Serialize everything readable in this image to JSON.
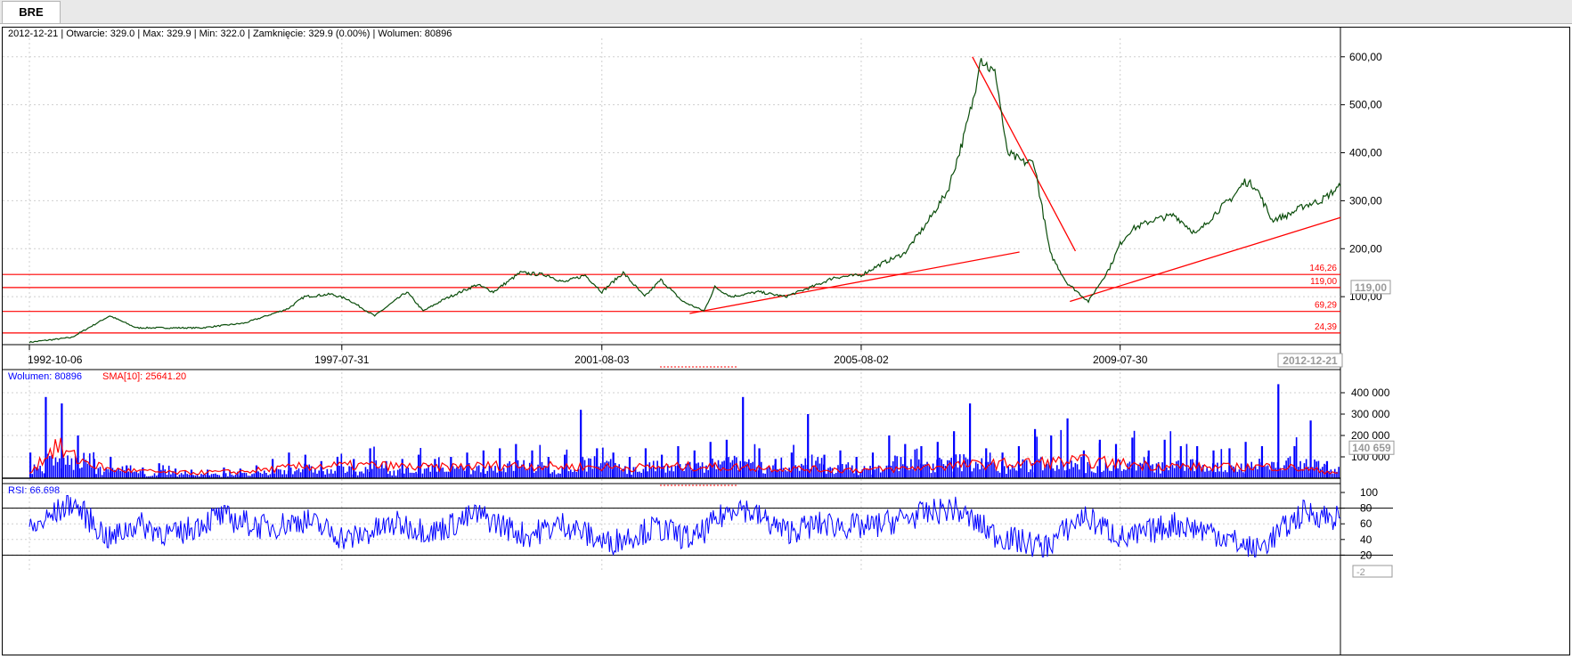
{
  "tab": {
    "label": "BRE"
  },
  "header": {
    "info": "2012-12-21 | Otwarcie: 329.0 | Max: 329.9 | Min: 322.0 | Zamknięcie: 329.9 (0.00%)  | Wolumen: 80896"
  },
  "colors": {
    "price_line": "#0a4d0a",
    "support_lines": "#ff0000",
    "volume_bars": "#0000ff",
    "volume_sma": "#ff0000",
    "rsi_line": "#0000ff",
    "grid": "#cfcfcf"
  },
  "chart_data": [
    {
      "type": "line",
      "title": "",
      "y_axis_labels": [
        "600,00",
        "500,00",
        "400,00",
        "300,00",
        "200,00",
        "100,00"
      ],
      "ylim": [
        0,
        620
      ],
      "x_tick_labels": [
        "1992-10-06",
        "1997-07-31",
        "2001-08-03",
        "2005-08-02",
        "2009-07-30"
      ],
      "x_range": [
        "1992-10-06",
        "2012-12-21"
      ],
      "current_date_label": "2012-12-21",
      "current_value_label": "119,00",
      "horizontal_levels": [
        {
          "value": 146.26,
          "label": "146,26"
        },
        {
          "value": 119.0,
          "label": "119,00"
        },
        {
          "value": 69.29,
          "label": "69,29"
        },
        {
          "value": 24.39,
          "label": "24,39"
        }
      ],
      "trend_lines": [
        {
          "from": [
            "2002-12-10",
            65
          ],
          "to": [
            "2008-01-10",
            193
          ]
        },
        {
          "from": [
            "2007-04-20",
            600
          ],
          "to": [
            "2008-11-20",
            195
          ]
        },
        {
          "from": [
            "2008-10-20",
            90
          ],
          "to": [
            "2012-12-21",
            265
          ]
        }
      ],
      "series": [
        {
          "values_x": [
            "1992-10-06",
            "1993-06-01",
            "1994-01-01",
            "1994-06-01",
            "1995-06-01",
            "1996-02-01",
            "1996-10-01",
            "1997-01-01",
            "1997-06-01",
            "1997-09-01",
            "1998-02-01",
            "1998-08-01",
            "1998-11-01",
            "1999-03-01",
            "1999-09-01",
            "1999-12-01",
            "2000-05-01",
            "2000-10-01",
            "2001-01-01",
            "2001-05-01",
            "2001-08-03",
            "2001-12-01",
            "2002-04-01",
            "2002-07-01",
            "2002-11-01",
            "2003-03-01",
            "2003-05-01",
            "2003-08-01",
            "2004-01-01",
            "2004-06-01",
            "2004-12-01",
            "2005-03-01",
            "2005-08-02",
            "2005-12-01",
            "2006-04-01",
            "2006-08-01",
            "2006-12-01",
            "2007-03-01",
            "2007-05-01",
            "2007-06-01",
            "2007-09-01",
            "2007-11-01",
            "2008-02-01",
            "2008-04-01",
            "2008-07-01",
            "2008-10-01",
            "2009-02-01",
            "2009-06-01",
            "2009-07-30",
            "2009-10-01",
            "2010-02-01",
            "2010-06-01",
            "2010-10-01",
            "2011-02-01",
            "2011-05-01",
            "2011-07-01",
            "2011-09-01",
            "2011-12-01",
            "2012-03-01",
            "2012-06-01",
            "2012-09-01",
            "2012-12-21"
          ],
          "values_y": [
            5,
            15,
            60,
            35,
            35,
            45,
            75,
            100,
            105,
            95,
            60,
            110,
            70,
            95,
            125,
            110,
            150,
            145,
            130,
            145,
            110,
            150,
            100,
            135,
            90,
            70,
            120,
            100,
            110,
            100,
            125,
            140,
            145,
            170,
            190,
            250,
            320,
            430,
            520,
            600,
            560,
            400,
            380,
            380,
            190,
            130,
            90,
            160,
            210,
            240,
            260,
            270,
            230,
            280,
            310,
            340,
            330,
            260,
            270,
            290,
            300,
            330
          ]
        }
      ]
    },
    {
      "type": "bar",
      "title": "",
      "legend_volume": "Wolumen: 80896",
      "legend_sma": "SMA[10]: 25641.20",
      "y_axis_labels": [
        "400 000",
        "300 000",
        "200 000",
        "100 000"
      ],
      "ylim": [
        0,
        450000
      ],
      "current_value_label": "140 659",
      "series": [
        {
          "x": [
            "1992-10-06",
            "1993-01-01",
            "1993-04-01",
            "1993-07-01",
            "1993-10-01",
            "1994-01-01",
            "1994-04-01",
            "1994-07-01",
            "1994-10-01",
            "1995-01-01",
            "1995-04-01",
            "1995-07-01",
            "1995-10-01",
            "1996-01-01",
            "1996-04-01",
            "1996-07-01",
            "1996-10-01",
            "1997-01-01",
            "1997-04-01",
            "1997-07-01",
            "1997-10-01",
            "1998-01-01",
            "1998-04-01",
            "1998-07-01",
            "1998-10-01",
            "1999-01-01",
            "1999-04-01",
            "1999-07-01",
            "1999-10-01",
            "2000-01-01",
            "2000-04-01",
            "2000-07-01",
            "2000-10-01",
            "2001-01-01",
            "2001-04-01",
            "2001-07-01",
            "2001-10-01",
            "2002-01-01",
            "2002-04-01",
            "2002-07-01",
            "2002-10-01",
            "2003-01-01",
            "2003-04-01",
            "2003-07-01",
            "2003-10-01",
            "2004-01-01",
            "2004-04-01",
            "2004-07-01",
            "2004-10-01",
            "2005-01-01",
            "2005-04-01",
            "2005-07-01",
            "2005-10-01",
            "2006-01-01",
            "2006-04-01",
            "2006-07-01",
            "2006-10-01",
            "2007-01-01",
            "2007-04-01",
            "2007-07-01",
            "2007-10-01",
            "2008-01-01",
            "2008-04-01",
            "2008-07-01",
            "2008-10-01",
            "2009-01-01",
            "2009-04-01",
            "2009-07-01",
            "2009-10-01",
            "2010-01-01",
            "2010-04-01",
            "2010-07-01",
            "2010-10-01",
            "2011-01-01",
            "2011-04-01",
            "2011-07-01",
            "2011-10-01",
            "2012-01-01",
            "2012-04-01",
            "2012-07-01",
            "2012-10-01"
          ],
          "values": [
            120000,
            380000,
            350000,
            200000,
            90000,
            100000,
            60000,
            50000,
            70000,
            45000,
            40000,
            40000,
            50000,
            45000,
            60000,
            90000,
            120000,
            110000,
            80000,
            100000,
            90000,
            140000,
            80000,
            90000,
            110000,
            90000,
            100000,
            120000,
            130000,
            140000,
            160000,
            130000,
            100000,
            110000,
            320000,
            140000,
            120000,
            100000,
            140000,
            110000,
            150000,
            130000,
            170000,
            180000,
            380000,
            140000,
            90000,
            120000,
            300000,
            110000,
            130000,
            100000,
            120000,
            200000,
            160000,
            150000,
            170000,
            220000,
            350000,
            140000,
            120000,
            150000,
            230000,
            200000,
            280000,
            130000,
            180000,
            160000,
            190000,
            130000,
            180000,
            150000,
            150000,
            130000,
            140000,
            170000,
            150000,
            440000,
            150000,
            270000,
            80000
          ]
        },
        {
          "name": "SMA[10]",
          "x": [
            "1992-10-06",
            "1993-03-01",
            "1993-07-01",
            "1994-01-01",
            "1995-01-01",
            "1996-01-01",
            "1997-01-01",
            "1998-01-01",
            "1999-01-01",
            "2000-01-01",
            "2001-01-01",
            "2002-01-01",
            "2003-01-01",
            "2004-01-01",
            "2005-01-01",
            "2006-01-01",
            "2007-01-01",
            "2008-01-01",
            "2009-01-01",
            "2010-01-01",
            "2011-01-01",
            "2012-01-01",
            "2012-12-21"
          ],
          "values": [
            30000,
            150000,
            90000,
            40000,
            25000,
            30000,
            55000,
            60000,
            50000,
            60000,
            55000,
            50000,
            55000,
            50000,
            40000,
            40000,
            60000,
            70000,
            80000,
            60000,
            50000,
            55000,
            25641
          ]
        }
      ]
    },
    {
      "type": "line",
      "title": "",
      "legend": "RSI: 66.698",
      "y_axis_labels": [
        "100",
        "80",
        "60",
        "40",
        "20"
      ],
      "ylim": [
        0,
        100
      ],
      "levels": [
        80,
        20
      ],
      "current_value_label": "-2",
      "series": [
        {
          "x": [
            "1992-10-06",
            "1993-06-01",
            "1994-01-01",
            "1994-06-01",
            "1995-01-01",
            "1995-09-01",
            "1996-06-01",
            "1997-01-01",
            "1997-09-01",
            "1998-06-01",
            "1999-01-01",
            "1999-09-01",
            "2000-06-01",
            "2001-01-01",
            "2001-09-01",
            "2002-06-01",
            "2003-01-01",
            "2003-09-01",
            "2004-06-01",
            "2005-01-01",
            "2005-09-01",
            "2006-06-01",
            "2007-01-01",
            "2007-09-01",
            "2008-06-01",
            "2009-01-01",
            "2009-09-01",
            "2010-06-01",
            "2011-01-01",
            "2011-09-01",
            "2012-06-01",
            "2012-12-21"
          ],
          "values": [
            50,
            88,
            40,
            60,
            45,
            70,
            55,
            65,
            40,
            60,
            50,
            72,
            45,
            60,
            35,
            55,
            40,
            85,
            50,
            60,
            55,
            70,
            80,
            45,
            30,
            70,
            40,
            60,
            50,
            25,
            75,
            67
          ]
        }
      ]
    }
  ]
}
